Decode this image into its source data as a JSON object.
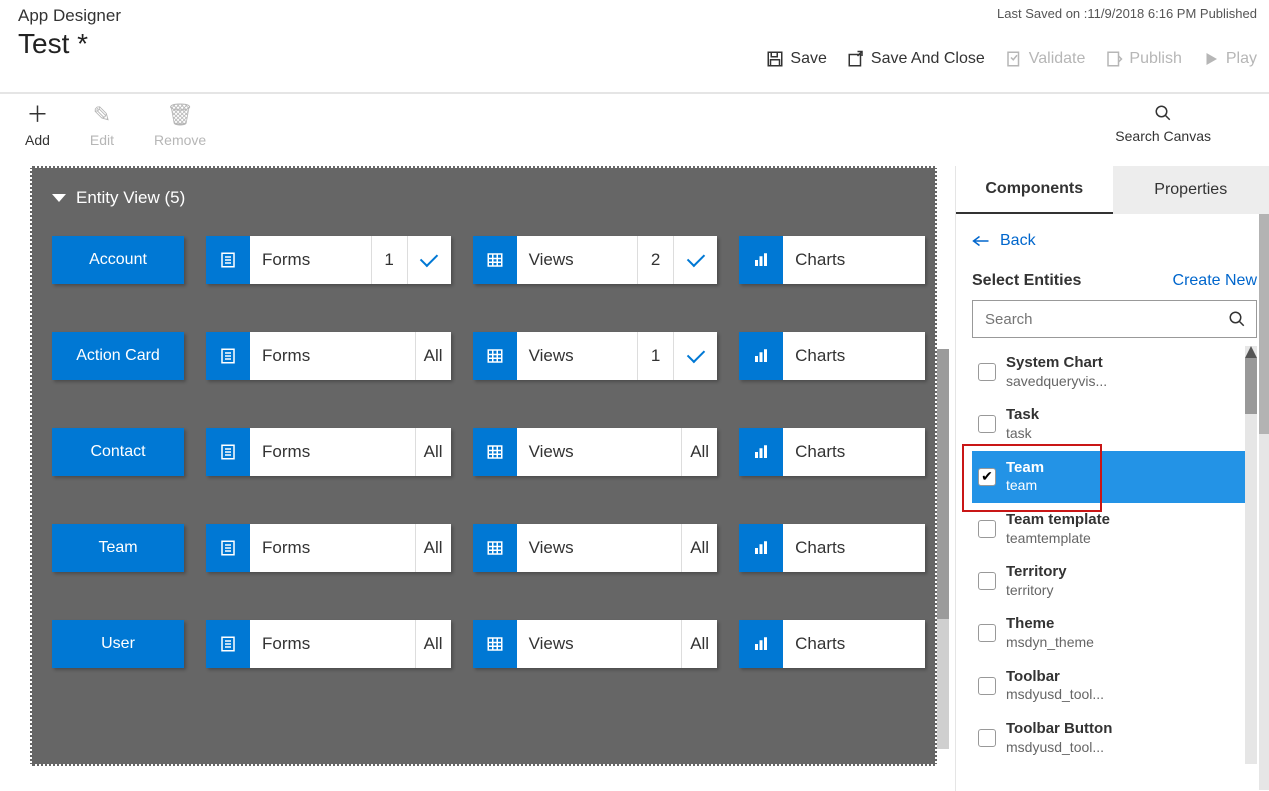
{
  "header": {
    "app_title": "App Designer",
    "app_name": "Test *",
    "last_saved": "Last Saved on :11/9/2018 6:16 PM Published",
    "save": "Save",
    "save_close": "Save And Close",
    "validate": "Validate",
    "publish": "Publish",
    "play": "Play"
  },
  "subtoolbar": {
    "add": "Add",
    "edit": "Edit",
    "remove": "Remove",
    "search_canvas": "Search Canvas"
  },
  "canvas": {
    "section_title": "Entity View (5)",
    "forms_label": "Forms",
    "views_label": "Views",
    "charts_label": "Charts",
    "all_label": "All",
    "rows": [
      {
        "name": "Account",
        "forms_count": "1",
        "views_count": "2",
        "forms_all": false,
        "views_all": false
      },
      {
        "name": "Action Card",
        "forms_count": "All",
        "views_count": "1",
        "forms_all": true,
        "views_all": false
      },
      {
        "name": "Contact",
        "forms_count": "All",
        "views_count": "All",
        "forms_all": true,
        "views_all": true
      },
      {
        "name": "Team",
        "forms_count": "All",
        "views_count": "All",
        "forms_all": true,
        "views_all": true
      },
      {
        "name": "User",
        "forms_count": "All",
        "views_count": "All",
        "forms_all": true,
        "views_all": true
      }
    ]
  },
  "panel": {
    "tab_components": "Components",
    "tab_properties": "Properties",
    "back": "Back",
    "select_entities": "Select Entities",
    "create_new": "Create New",
    "search_placeholder": "Search",
    "entities": [
      {
        "label": "System Chart",
        "schema": "savedqueryvis...",
        "selected": false
      },
      {
        "label": "Task",
        "schema": "task",
        "selected": false
      },
      {
        "label": "Team",
        "schema": "team",
        "selected": true
      },
      {
        "label": "Team template",
        "schema": "teamtemplate",
        "selected": false
      },
      {
        "label": "Territory",
        "schema": "territory",
        "selected": false
      },
      {
        "label": "Theme",
        "schema": "msdyn_theme",
        "selected": false
      },
      {
        "label": "Toolbar",
        "schema": "msdyusd_tool...",
        "selected": false
      },
      {
        "label": "Toolbar Button",
        "schema": "msdyusd_tool...",
        "selected": false
      }
    ]
  }
}
